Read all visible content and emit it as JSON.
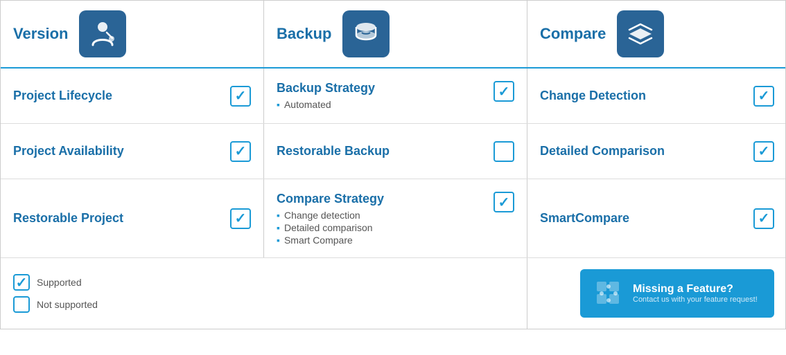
{
  "header": {
    "col1_title": "Version",
    "col2_title": "Backup",
    "col3_title": "Compare"
  },
  "rows": [
    {
      "col1_label": "Project Lifecycle",
      "col1_checked": true,
      "col2_label": "Backup Strategy",
      "col2_sub": [
        "Automated"
      ],
      "col2_checked": true,
      "col3_label": "Change Detection",
      "col3_checked": true
    },
    {
      "col1_label": "Project Availability",
      "col1_checked": true,
      "col2_label": "Restorable Backup",
      "col2_sub": [],
      "col2_checked": false,
      "col3_label": "Detailed Comparison",
      "col3_checked": true
    },
    {
      "col1_label": "Restorable Project",
      "col1_checked": true,
      "col2_label": "Compare Strategy",
      "col2_sub": [
        "Change detection",
        "Detailed comparison",
        "Smart Compare"
      ],
      "col2_checked": true,
      "col3_label": "SmartCompare",
      "col3_checked": true
    }
  ],
  "legend": {
    "supported_label": "Supported",
    "not_supported_label": "Not supported"
  },
  "cta": {
    "main_text": "Missing a Feature?",
    "sub_text": "Contact us with your feature request!"
  }
}
